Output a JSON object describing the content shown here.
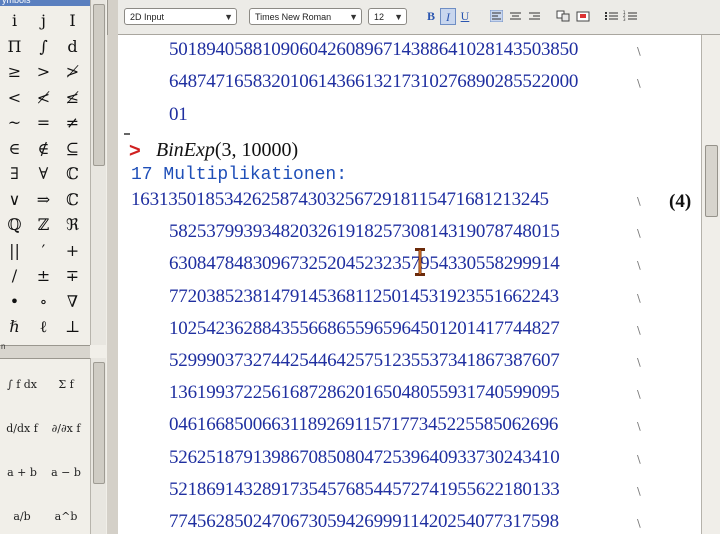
{
  "palette": {
    "title": "ymbols",
    "symbols": [
      [
        "i",
        "j",
        "I"
      ],
      [
        "Π",
        "∫",
        "d"
      ],
      [
        "≥",
        ">",
        "≯"
      ],
      [
        "<",
        "≮",
        "≰"
      ],
      [
        "~",
        "=",
        "≠"
      ],
      [
        "∈",
        "∉",
        "⊆"
      ],
      [
        "∃",
        "∀",
        "ℂ"
      ],
      [
        "∨",
        "⇒",
        "ℂ"
      ],
      [
        "ℚ",
        "ℤ",
        "ℜ"
      ],
      [
        "||",
        "′",
        "+"
      ],
      [
        "/",
        "±",
        "∓"
      ],
      [
        "•",
        "∘",
        "∇"
      ],
      [
        "ℏ",
        "ℓ",
        "⊥"
      ]
    ],
    "divider_label": "n",
    "expressions": [
      [
        "∫ f dx",
        "Σ f"
      ],
      [
        "d/dx f",
        "∂/∂x f"
      ],
      [
        "a + b",
        "a − b"
      ],
      [
        "a/b",
        "a^b"
      ]
    ]
  },
  "toolbar": {
    "mode_value": "2D Input",
    "font_value": "Times New Roman",
    "size_value": "12",
    "bold_label": "B",
    "italic_label": "I",
    "underline_label": "U"
  },
  "worksheet": {
    "prev_lines": [
      "50189405881090604260896714388641028143503850",
      "64874716583201061436613217310276890285522000",
      "01"
    ],
    "prompt_symbol": ">",
    "command_func": "BinExp",
    "command_args": "(3, 10000)",
    "multiplications_text": "17 Multiplikationen:",
    "equation_label": "(4)",
    "result_lines": [
      "163135018534262587430325672918115471681213245",
      "582537993934820326191825730814319078748015",
      "630847848309673252045232357954330558299914",
      "772038523814791453681125014531923551662243",
      "102542362884355668655965964501201417744827",
      "529990373274425446425751235537341867387607",
      "136199372256168728620165048055931740599095",
      "046166850066311892691157177345225585062696",
      "526251879139867085080472539640933730243410",
      "521869143289173545768544572741955622180133",
      "774562850247067305942699911420254077317598"
    ],
    "continuation_mark": "\\"
  }
}
